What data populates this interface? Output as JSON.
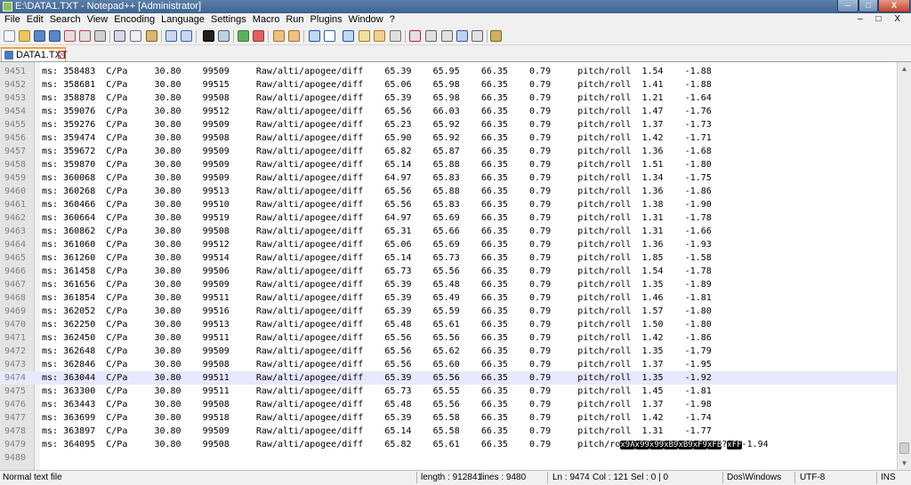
{
  "window": {
    "title": "E:\\DATA1.TXT - Notepad++ [Administrator]"
  },
  "menu": [
    "File",
    "Edit",
    "Search",
    "View",
    "Encoding",
    "Language",
    "Settings",
    "Macro",
    "Run",
    "Plugins",
    "Window",
    "?"
  ],
  "menu_right": "– □ X",
  "tab": {
    "label": "DATA1.TXT"
  },
  "lines": [
    {
      "n": "9451",
      "ms": "358483",
      "alt": "99509",
      "a": "65.39",
      "b": "65.95",
      "p": "1.54",
      "r": "-1.88"
    },
    {
      "n": "9452",
      "ms": "358681",
      "alt": "99515",
      "a": "65.06",
      "b": "65.98",
      "p": "1.41",
      "r": "-1.88"
    },
    {
      "n": "9453",
      "ms": "358878",
      "alt": "99508",
      "a": "65.39",
      "b": "65.98",
      "p": "1.21",
      "r": "-1.64"
    },
    {
      "n": "9454",
      "ms": "359076",
      "alt": "99512",
      "a": "65.56",
      "b": "66.03",
      "p": "1.47",
      "r": "-1.76"
    },
    {
      "n": "9455",
      "ms": "359276",
      "alt": "99509",
      "a": "65.23",
      "b": "65.92",
      "p": "1.37",
      "r": "-1.73"
    },
    {
      "n": "9456",
      "ms": "359474",
      "alt": "99508",
      "a": "65.90",
      "b": "65.92",
      "p": "1.42",
      "r": "-1.71"
    },
    {
      "n": "9457",
      "ms": "359672",
      "alt": "99509",
      "a": "65.82",
      "b": "65.87",
      "p": "1.36",
      "r": "-1.68"
    },
    {
      "n": "9458",
      "ms": "359870",
      "alt": "99509",
      "a": "65.14",
      "b": "65.88",
      "p": "1.51",
      "r": "-1.80"
    },
    {
      "n": "9459",
      "ms": "360068",
      "alt": "99509",
      "a": "64.97",
      "b": "65.83",
      "p": "1.34",
      "r": "-1.75"
    },
    {
      "n": "9460",
      "ms": "360268",
      "alt": "99513",
      "a": "65.56",
      "b": "65.88",
      "p": "1.36",
      "r": "-1.86"
    },
    {
      "n": "9461",
      "ms": "360466",
      "alt": "99510",
      "a": "65.56",
      "b": "65.83",
      "p": "1.38",
      "r": "-1.90"
    },
    {
      "n": "9462",
      "ms": "360664",
      "alt": "99519",
      "a": "64.97",
      "b": "65.69",
      "p": "1.31",
      "r": "-1.78"
    },
    {
      "n": "9463",
      "ms": "360862",
      "alt": "99508",
      "a": "65.31",
      "b": "65.66",
      "p": "1.31",
      "r": "-1.66"
    },
    {
      "n": "9464",
      "ms": "361060",
      "alt": "99512",
      "a": "65.06",
      "b": "65.69",
      "p": "1.36",
      "r": "-1.93"
    },
    {
      "n": "9465",
      "ms": "361260",
      "alt": "99514",
      "a": "65.14",
      "b": "65.73",
      "p": "1.85",
      "r": "-1.58"
    },
    {
      "n": "9466",
      "ms": "361458",
      "alt": "99506",
      "a": "65.73",
      "b": "65.56",
      "p": "1.54",
      "r": "-1.78"
    },
    {
      "n": "9467",
      "ms": "361656",
      "alt": "99509",
      "a": "65.39",
      "b": "65.48",
      "p": "1.35",
      "r": "-1.89"
    },
    {
      "n": "9468",
      "ms": "361854",
      "alt": "99511",
      "a": "65.39",
      "b": "65.49",
      "p": "1.46",
      "r": "-1.81"
    },
    {
      "n": "9469",
      "ms": "362052",
      "alt": "99516",
      "a": "65.39",
      "b": "65.59",
      "p": "1.57",
      "r": "-1.80"
    },
    {
      "n": "9470",
      "ms": "362250",
      "alt": "99513",
      "a": "65.48",
      "b": "65.61",
      "p": "1.50",
      "r": "-1.80"
    },
    {
      "n": "9471",
      "ms": "362450",
      "alt": "99511",
      "a": "65.56",
      "b": "65.56",
      "p": "1.42",
      "r": "-1.86"
    },
    {
      "n": "9472",
      "ms": "362648",
      "alt": "99509",
      "a": "65.56",
      "b": "65.62",
      "p": "1.35",
      "r": "-1.79"
    },
    {
      "n": "9473",
      "ms": "362846",
      "alt": "99508",
      "a": "65.56",
      "b": "65.60",
      "p": "1.37",
      "r": "-1.95"
    },
    {
      "n": "9474",
      "ms": "363044",
      "alt": "99511",
      "a": "65.39",
      "b": "65.56",
      "p": "1.35",
      "r": "-1.92"
    },
    {
      "n": "9475",
      "ms": "363300",
      "alt": "99511",
      "a": "65.73",
      "b": "65.55",
      "p": "1.45",
      "r": "-1.81"
    },
    {
      "n": "9476",
      "ms": "363443",
      "alt": "99508",
      "a": "65.48",
      "b": "65.56",
      "p": "1.37",
      "r": "-1.98"
    },
    {
      "n": "9477",
      "ms": "363699",
      "alt": "99518",
      "a": "65.39",
      "b": "65.58",
      "p": "1.42",
      "r": "-1.74"
    },
    {
      "n": "9478",
      "ms": "363897",
      "alt": "99509",
      "a": "65.14",
      "b": "65.58",
      "p": "1.31",
      "r": "-1.77"
    }
  ],
  "line_const": {
    "label": "ms:",
    "unit": "C/Pa",
    "temp": "30.80",
    "tag": "Raw/alti/apogee/diff",
    "c": "66.35",
    "d": "0.79",
    "pr": "pitch/roll"
  },
  "line_9479": {
    "n": "9479",
    "ms": "364095",
    "alt": "99508",
    "a": "65.82",
    "b": "65.61",
    "prefix": "pitch/ro",
    "ctl": [
      "x9A",
      "x99",
      "x99",
      "xB9",
      "xB9",
      "xF9",
      "xFB"
    ],
    "qmark": "?",
    "ctl_last": "xFF",
    "tail": "-1.94"
  },
  "line_9480": {
    "n": "9480"
  },
  "current_line": "9474",
  "status": {
    "type": "Normal text file",
    "length": "length : 912841",
    "lines": "lines : 9480",
    "ln": "Ln : 9474",
    "col": "Col : 121",
    "sel": "Sel : 0 | 0",
    "eol": "Dos\\Windows",
    "enc": "UTF-8",
    "mode": "INS"
  }
}
